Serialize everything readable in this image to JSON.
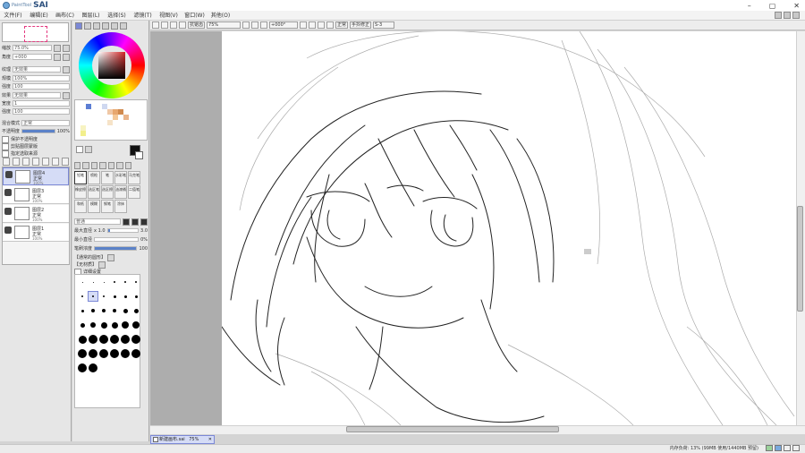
{
  "app": {
    "brand": "PaintTool",
    "name": "SAI"
  },
  "menu": [
    "文件(F)",
    "编辑(E)",
    "画布(C)",
    "图层(L)",
    "选择(S)",
    "滤镜(T)",
    "视图(V)",
    "窗口(W)",
    "其他(O)"
  ],
  "navigator": {
    "zoom_label": "缩放",
    "zoom_value": "75.0%",
    "angle_label": "角度",
    "angle_value": "+000"
  },
  "layer_props": {
    "effect_label": "纹理",
    "effect_value": "无效果",
    "scale_label": "规模",
    "scale_value": "100%",
    "strength_label": "强度",
    "strength_value": "100",
    "effect2_label": "效果",
    "effect2_value": "无效果",
    "width_label": "宽度",
    "width_value": "1",
    "strength2_label": "强度",
    "strength2_value": "100",
    "mode_label": "混合模式",
    "mode_value": "正常",
    "opacity_label": "不透明度",
    "opacity_value": "100%",
    "chk1": "保护不透明度",
    "chk2": "剪贴图层蒙版",
    "chk3": "指定选取来源"
  },
  "layers": [
    {
      "name": "图层4",
      "mode": "正常",
      "opacity": "100%",
      "selected": true
    },
    {
      "name": "图层3",
      "mode": "正常",
      "opacity": "100%",
      "selected": false
    },
    {
      "name": "图层2",
      "mode": "正常",
      "opacity": "100%",
      "selected": false
    },
    {
      "name": "图层1",
      "mode": "正常",
      "opacity": "100%",
      "selected": false
    }
  ],
  "tools": [
    "铅笔",
    "喷枪",
    "笔",
    "水彩笔",
    "马克笔",
    "橡皮擦",
    "选区笔",
    "选区擦",
    "油漆桶",
    "二值笔",
    "和纸",
    "模糊",
    "钢笔",
    "涂抹"
  ],
  "brush": {
    "mode_label": "普通",
    "size_label": "最大直径",
    "size_mult": "x 1.0",
    "size_value": "3.0",
    "min_label": "最小直径",
    "min_value": "0%",
    "density_label": "笔刷浓度",
    "density_value": "100",
    "shape_label": "【通常的圆形】",
    "texture_label": "【无材质】",
    "detail_label": "详细设置"
  },
  "brush_sizes": [
    "0.7",
    "0.8",
    "1",
    "1.5",
    "2",
    "2.3",
    "2.6",
    "3",
    "3.5",
    "4",
    "5",
    "6",
    "7",
    "8",
    "9",
    "10",
    "12",
    "14",
    "16",
    "20",
    "25",
    "30",
    "35",
    "40",
    "50",
    "60",
    "70",
    "80",
    "100",
    "120",
    "150",
    "200",
    "250",
    "300",
    "350",
    "400",
    "450",
    "500"
  ],
  "toolbar": {
    "zoom": "75%",
    "angle": "+000°",
    "stabilizer_label": "手抖修正",
    "stabilizer_value": "S-3",
    "checkbox": "抗锯齿",
    "mode": "正常"
  },
  "document": {
    "tab_label": "新建画布.sai",
    "tab_zoom": "75%"
  },
  "status": "内存负荷: 13% (99MB 使用/1440MB 预留)",
  "colors": {
    "accent": "#7b88d6",
    "primary": "#111111",
    "secondary": "#ffffff"
  }
}
